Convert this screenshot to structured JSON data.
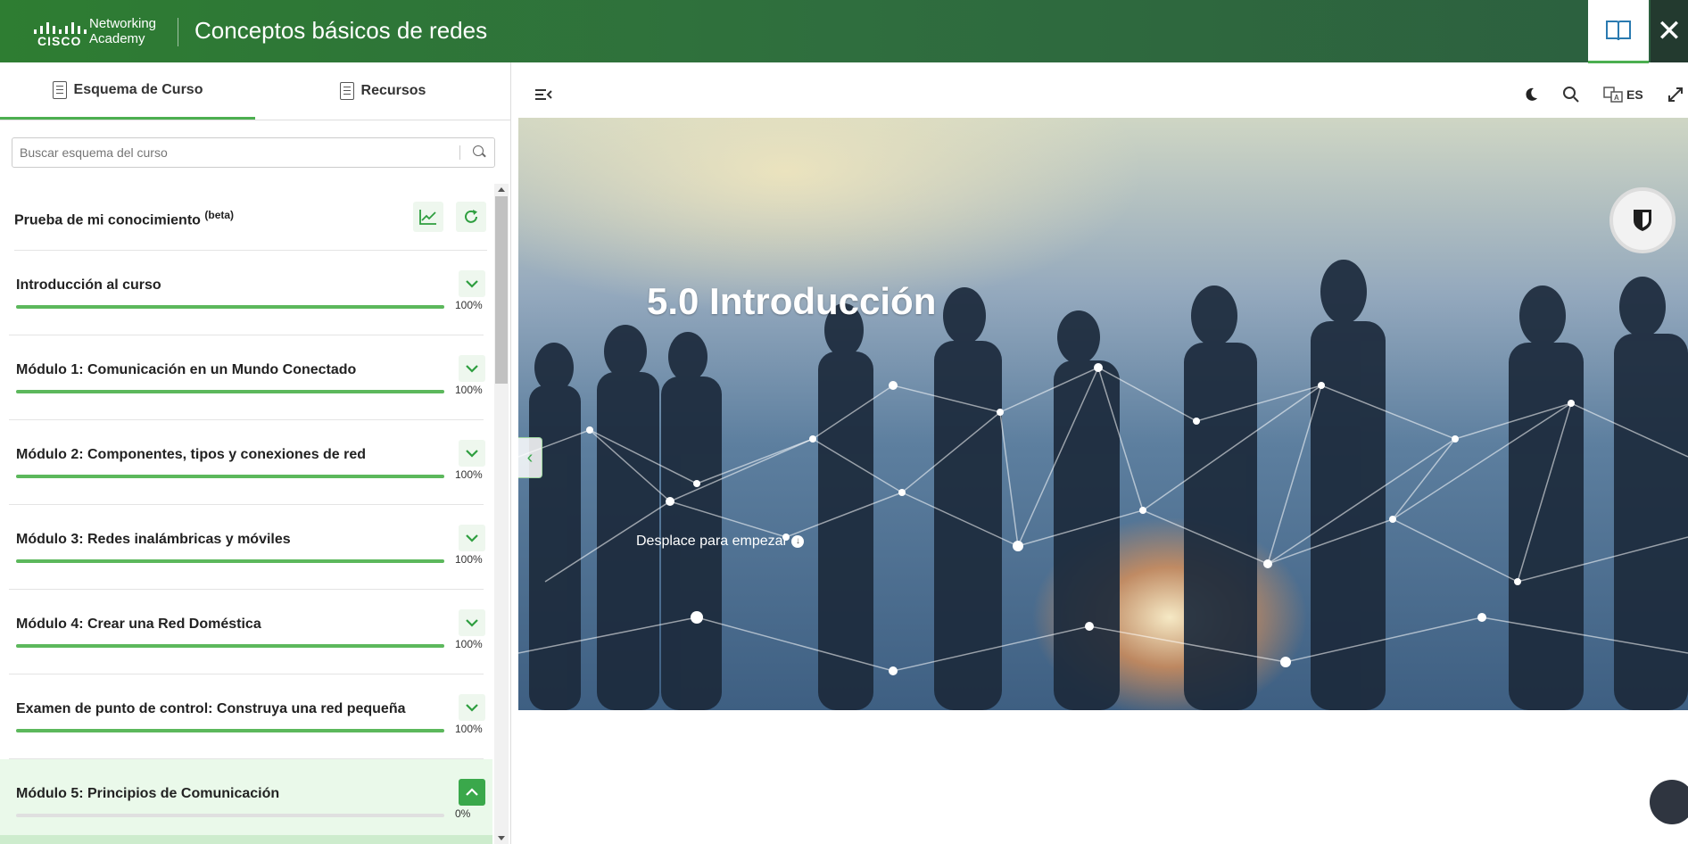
{
  "header": {
    "brand_line1": "Networking",
    "brand_line2": "Academy",
    "brand_logo": "CISCO",
    "title": "Conceptos básicos de redes",
    "book_icon": "book-icon",
    "close_label": "✕"
  },
  "sidebar": {
    "tabs": [
      {
        "label": "Esquema de Curso",
        "active": true
      },
      {
        "label": "Recursos",
        "active": false
      }
    ],
    "search_placeholder": "Buscar esquema del curso",
    "quiz": {
      "label": "Prueba de mi conocimiento",
      "tag": "(beta)"
    },
    "modules": [
      {
        "title": "Introducción al curso",
        "percent": "100%",
        "progress": 1.0
      },
      {
        "title": "Módulo 1: Comunicación en un Mundo Conectado",
        "percent": "100%",
        "progress": 1.0
      },
      {
        "title": "Módulo 2: Componentes, tipos y conexiones de red",
        "percent": "100%",
        "progress": 1.0
      },
      {
        "title": "Módulo 3: Redes inalámbricas y móviles",
        "percent": "100%",
        "progress": 1.0
      },
      {
        "title": "Módulo 4: Crear una Red Doméstica",
        "percent": "100%",
        "progress": 1.0
      },
      {
        "title": "Examen de punto de control: Construya una red pequeña",
        "percent": "100%",
        "progress": 1.0
      },
      {
        "title": "Módulo 5: Principios de Comunicación",
        "percent": "0%",
        "progress": 0.0,
        "current": true
      }
    ]
  },
  "toolbar": {
    "language": "ES"
  },
  "hero": {
    "title": "5.0 Introducción",
    "subtitle": "Desplace para empezar"
  },
  "colors": {
    "brand_green": "#2e7d32",
    "progress_green": "#5cb85c",
    "current_bg": "#eaf9ea"
  }
}
